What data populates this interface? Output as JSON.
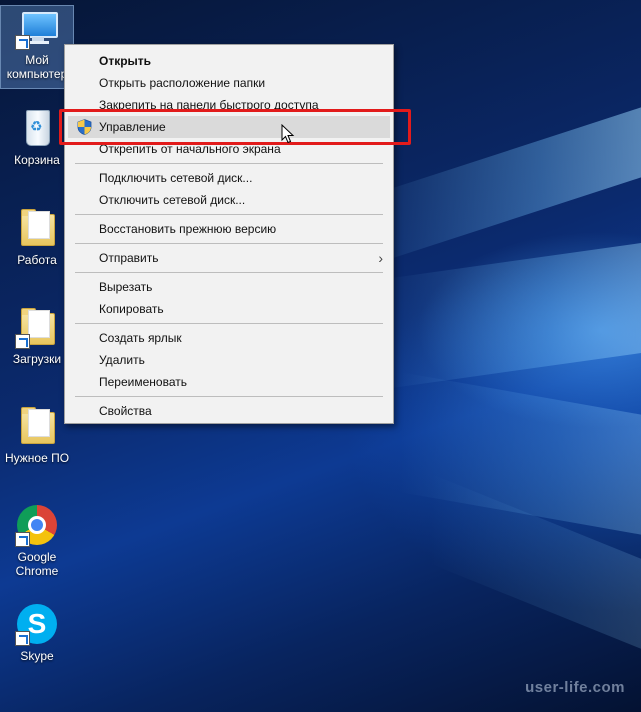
{
  "desktop_icons": [
    {
      "label": "Мой компьютер",
      "icon": "computer-icon",
      "shortcut": true,
      "selected": true
    },
    {
      "label": "Корзина",
      "icon": "recycle-bin-icon",
      "shortcut": false
    },
    {
      "label": "Работа",
      "icon": "folder-icon",
      "shortcut": false
    },
    {
      "label": "Загрузки",
      "icon": "folder-icon",
      "shortcut": true
    },
    {
      "label": "Нужное ПО",
      "icon": "folder-icon",
      "shortcut": false
    },
    {
      "label_line1": "Google",
      "label_line2": "Chrome",
      "icon": "chrome-icon",
      "shortcut": true
    },
    {
      "label": "Skype",
      "icon": "skype-icon",
      "shortcut": true
    }
  ],
  "context_menu": {
    "items": [
      {
        "label": "Открыть",
        "bold": true
      },
      {
        "label": "Открыть расположение папки"
      },
      {
        "label": "Закрепить на панели быстрого доступа"
      },
      {
        "label": "Управление",
        "icon": "uac-shield-icon",
        "highlighted": true
      },
      {
        "label": "Открепить от начального экрана"
      },
      {
        "label": "Подключить сетевой диск..."
      },
      {
        "label": "Отключить сетевой диск..."
      },
      {
        "label": "Восстановить прежнюю версию"
      },
      {
        "label": "Отправить",
        "submenu": true,
        "arrow": "›"
      },
      {
        "label": "Вырезать"
      },
      {
        "label": "Копировать"
      },
      {
        "label": "Создать ярлык"
      },
      {
        "label": "Удалить"
      },
      {
        "label": "Переименовать"
      },
      {
        "label": "Свойства"
      }
    ]
  },
  "watermark": "user-life.com",
  "colors": {
    "highlight_box": "#e21b1b",
    "menu_bg": "#f2f2f2",
    "desktop_accent": "#0d3a93"
  }
}
